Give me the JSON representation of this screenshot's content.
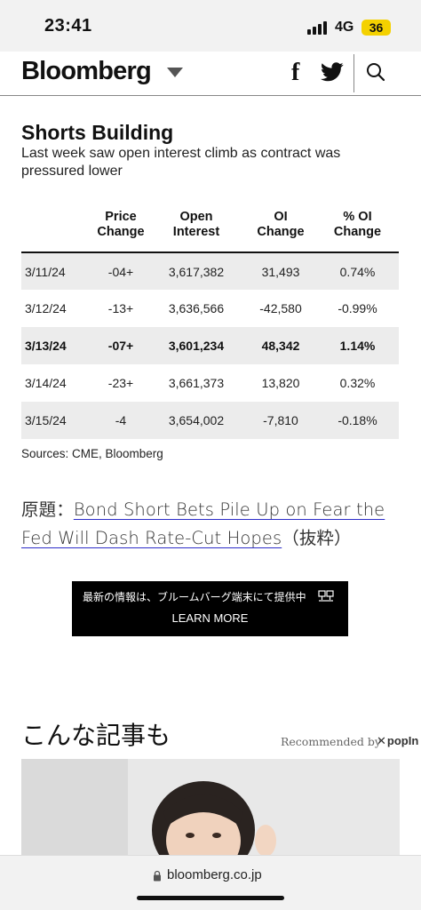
{
  "status": {
    "time": "23:41",
    "network": "4G",
    "battery": "36"
  },
  "header": {
    "logo": "Bloomberg"
  },
  "chart": {
    "title": "Shorts Building",
    "subtitle": "Last week saw open interest climb as contract was pressured lower",
    "columns": [
      {
        "line1": "",
        "line2": ""
      },
      {
        "line1": "Price",
        "line2": "Change"
      },
      {
        "line1": "Open",
        "line2": "Interest"
      },
      {
        "line1": "OI",
        "line2": "Change"
      },
      {
        "line1": "% OI",
        "line2": "Change"
      }
    ],
    "rows": [
      {
        "date": "3/11/24",
        "price_change": "-04+",
        "open_interest": "3,617,382",
        "oi_change": "31,493",
        "pct_oi_change": "0.74%"
      },
      {
        "date": "3/12/24",
        "price_change": "-13+",
        "open_interest": "3,636,566",
        "oi_change": "-42,580",
        "pct_oi_change": "-0.99%"
      },
      {
        "date": "3/13/24",
        "price_change": "-07+",
        "open_interest": "3,601,234",
        "oi_change": "48,342",
        "pct_oi_change": "1.14%"
      },
      {
        "date": "3/14/24",
        "price_change": "-23+",
        "open_interest": "3,661,373",
        "oi_change": "13,820",
        "pct_oi_change": "0.32%"
      },
      {
        "date": "3/15/24",
        "price_change": "-4",
        "open_interest": "3,654,002",
        "oi_change": "-7,810",
        "pct_oi_change": "-0.18%"
      }
    ],
    "sources": "Sources: CME, Bloomberg"
  },
  "original": {
    "prefix": "原題：",
    "link": "Bond Short Bets Pile Up on Fear the Fed Will Dash Rate-Cut Hopes",
    "suffix": "（抜粋）"
  },
  "promo": {
    "text": "最新の情報は、ブルームバーグ端末にて提供中",
    "cta": "LEARN MORE"
  },
  "related": {
    "heading": "こんな記事も",
    "recommended": "Recommended by",
    "brand": "popIn"
  },
  "url_bar": {
    "domain": "bloomberg.co.jp"
  },
  "colors": {
    "link_underline": "#2c2cc8",
    "battery": "#f4d100",
    "row_shade": "#ececec"
  }
}
